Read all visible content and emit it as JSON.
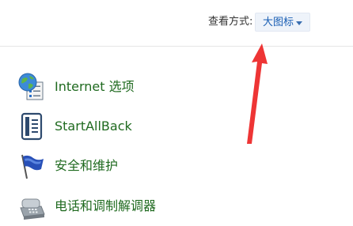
{
  "header": {
    "view_by_label": "查看方式:",
    "view_by_value": "大图标"
  },
  "items": [
    {
      "label": "Internet 选项",
      "icon": "internet-options-icon"
    },
    {
      "label": "StartAllBack",
      "icon": "startallback-icon"
    },
    {
      "label": "安全和维护",
      "icon": "security-flag-icon"
    },
    {
      "label": "电话和调制解调器",
      "icon": "phone-modem-icon"
    }
  ],
  "colors": {
    "link_text": "#1f6a1f",
    "dropdown_text": "#1a5fb4",
    "annotation_arrow": "#ee3535"
  }
}
